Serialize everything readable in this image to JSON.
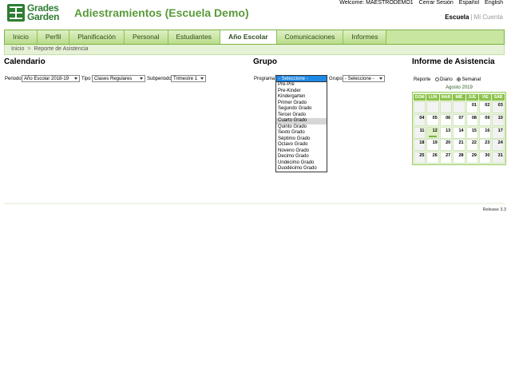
{
  "logo": {
    "line1": "Grades",
    "line2": "Garden"
  },
  "app_title": "Adiestramientos (Escuela Demo)",
  "top_links": {
    "welcome": "Welcome: MAESTRODEMO1",
    "logout": "Cerrar Sesión",
    "lang_es": "Español",
    "lang_en": "English"
  },
  "mode_links": {
    "school": "Escuela",
    "separator": "|",
    "account": "Mi Cuenta"
  },
  "nav": {
    "tabs": [
      {
        "label": "Inicio"
      },
      {
        "label": "Perfil"
      },
      {
        "label": "Planificación"
      },
      {
        "label": "Personal"
      },
      {
        "label": "Estudiantes"
      },
      {
        "label": "Año Escolar"
      },
      {
        "label": "Comunicaciones"
      },
      {
        "label": "Informes"
      }
    ],
    "active_index": 5
  },
  "breadcrumb": {
    "home": "Inicio",
    "arrow": ">",
    "current": "Reporte de Asistencia"
  },
  "calendario": {
    "title": "Calendario",
    "periodo_label": "Periodo",
    "periodo_value": "Año Escolar 2018-19",
    "tipo_label": "Tipo",
    "tipo_value": "Clases Regulares",
    "subperiodo_label": "Subperiodo",
    "subperiodo_value": "Trimestre 1"
  },
  "grupo": {
    "title": "Grupo",
    "programa_label": "Programa",
    "programa_selected": "- Seleccione -",
    "grupo_label": "Grupo",
    "grupo_value": "- Seleccione -",
    "options": [
      "Pre-Pre",
      "Pre-Kinder",
      "Kindergarten",
      "Primer Grado",
      "Segundo Grado",
      "Tercer Grado",
      "Cuarto Grado",
      "Quinto Grado",
      "Sexto Grado",
      "Séptimo Grado",
      "Octavo Grado",
      "Noveno Grado",
      "Decimo Grado",
      "Undécimo Grado",
      "Duodécimo Grado"
    ],
    "hover_index": 6
  },
  "informe": {
    "title": "Informe de Asistencia",
    "reporte_label": "Reporte",
    "diario_label": "Diario",
    "semanal_label": "Semanal",
    "selected": "Semanal",
    "month": "Agosto 2019",
    "weekdays": [
      "DOM",
      "LUN",
      "MAR",
      "MIÉ",
      "JUE",
      "VIE",
      "SÁB"
    ],
    "weeks": [
      [
        "",
        "",
        "",
        "",
        "01",
        "02",
        "03"
      ],
      [
        "04",
        "05",
        "06",
        "07",
        "08",
        "09",
        "10"
      ],
      [
        "11",
        "12",
        "13",
        "14",
        "15",
        "16",
        "17"
      ],
      [
        "18",
        "19",
        "20",
        "21",
        "22",
        "23",
        "24"
      ],
      [
        "25",
        "26",
        "27",
        "28",
        "29",
        "30",
        "31"
      ]
    ],
    "today": "12"
  },
  "release": "Release 3.3",
  "colors": {
    "accent_green": "#8bc34a",
    "title_green": "#5a9a3a",
    "select_blue": "#1e88e5"
  }
}
